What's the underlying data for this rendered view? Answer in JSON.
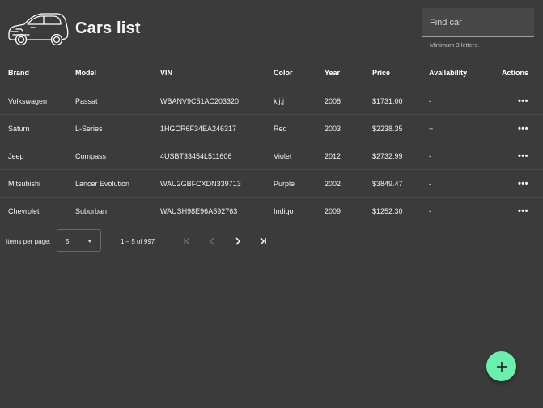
{
  "header": {
    "title": "Cars list"
  },
  "search": {
    "placeholder": "Find car",
    "hint": "Minimum 3 letters."
  },
  "table": {
    "columns": [
      "Brand",
      "Model",
      "VIN",
      "Color",
      "Year",
      "Price",
      "Availability",
      "Actions"
    ],
    "rows": [
      {
        "brand": "Volkswagen",
        "model": "Passat",
        "vin": "WBANV9C51AC203320",
        "color": "klj;j",
        "year": "2008",
        "price": "$1731.00",
        "availability": "-",
        "actions": "•••"
      },
      {
        "brand": "Saturn",
        "model": "L-Series",
        "vin": "1HGCR6F34EA246317",
        "color": "Red",
        "year": "2003",
        "price": "$2238.35",
        "availability": "+",
        "actions": "•••"
      },
      {
        "brand": "Jeep",
        "model": "Compass",
        "vin": "4USBT33454L511606",
        "color": "Violet",
        "year": "2012",
        "price": "$2732.99",
        "availability": "-",
        "actions": "•••"
      },
      {
        "brand": "Mitsubishi",
        "model": "Lancer Evolution",
        "vin": "WAU2GBFCXDN339713",
        "color": "Purple",
        "year": "2002",
        "price": "$3849.47",
        "availability": "-",
        "actions": "•••"
      },
      {
        "brand": "Chevrolet",
        "model": "Suburban",
        "vin": "WAUSH98E96A592763",
        "color": "Indigo",
        "year": "2009",
        "price": "$1252.30",
        "availability": "-",
        "actions": "•••"
      }
    ]
  },
  "paginator": {
    "items_per_page_label": "Items per page:",
    "items_per_page": "5",
    "range": "1 – 5 of 997"
  },
  "colors": {
    "background": "#3b3b3b",
    "fab": "#69f0ae"
  },
  "icons": {
    "logo": "car-icon",
    "fab": "plus-icon"
  }
}
